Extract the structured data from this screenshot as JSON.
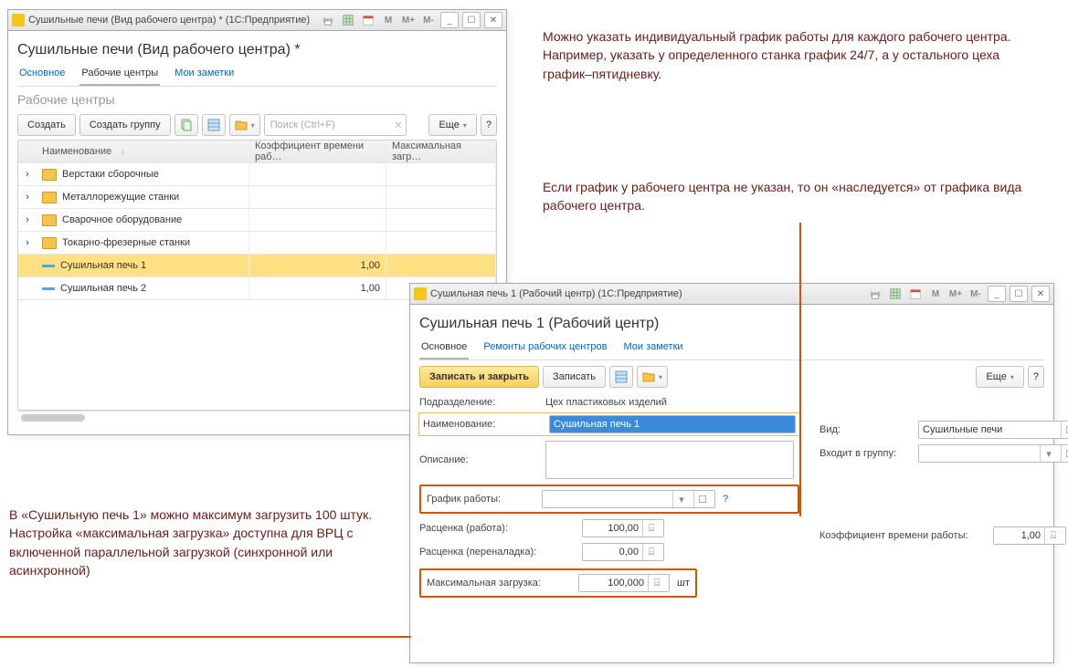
{
  "win1": {
    "titlebar": "Сушильные печи (Вид рабочего центра) * (1С:Предприятие)",
    "heading": "Сушильные печи (Вид рабочего центра) *",
    "tabs": {
      "main": "Основное",
      "centers": "Рабочие центры",
      "notes": "Мои заметки"
    },
    "subhead": "Рабочие центры",
    "toolbar": {
      "create": "Создать",
      "create_group": "Создать группу",
      "more": "Еще",
      "search_ph": "Поиск (Ctrl+F)"
    },
    "columns": {
      "name": "Наименование",
      "coef": "Коэффициент времени раб…",
      "load": "Максимальная загр…"
    },
    "rows": [
      {
        "type": "folder",
        "name": "Верстаки сборочные"
      },
      {
        "type": "folder",
        "name": "Металлорежущие станки"
      },
      {
        "type": "folder",
        "name": "Сварочное оборудование"
      },
      {
        "type": "folder",
        "name": "Токарно-фрезерные станки"
      },
      {
        "type": "leaf",
        "name": "Сушильная печь 1",
        "coef": "1,00",
        "selected": true
      },
      {
        "type": "leaf",
        "name": "Сушильная печь 2",
        "coef": "1,00"
      }
    ]
  },
  "win2": {
    "titlebar": "Сушильная печь 1 (Рабочий центр) (1С:Предприятие)",
    "heading": "Сушильная печь 1 (Рабочий центр)",
    "tabs": {
      "main": "Основное",
      "repairs": "Ремонты рабочих центров",
      "notes": "Мои заметки"
    },
    "toolbar": {
      "save_close": "Записать и закрыть",
      "save": "Записать",
      "more": "Еще"
    },
    "labels": {
      "unit": "Подразделение:",
      "name": "Наименование:",
      "desc": "Описание:",
      "schedule": "График работы:",
      "rate_work": "Расценка (работа):",
      "rate_setup": "Расценка (переналадка):",
      "max_load": "Максимальная загрузка:",
      "max_load_unit": "шт",
      "kind": "Вид:",
      "group": "Входит в группу:",
      "coef": "Коэффициент времени работы:"
    },
    "values": {
      "unit": "Цех пластиковых изделий",
      "name": "Сушильная печь 1",
      "rate_work": "100,00",
      "rate_setup": "0,00",
      "max_load": "100,000",
      "kind": "Сушильные печи",
      "coef": "1,00"
    }
  },
  "notes": {
    "top": "Можно указать индивидуальный  график работы для каждого рабочего центра. Например,  указать у определенного станка график 24/7, а у остального цеха график–пятидневку.",
    "mid": "Если график у рабочего центра не указан, то он «наследуется» от графика вида рабочего центра.",
    "left": "В «Сушильную печь 1» можно максимум загрузить 100 штук. Настройка «максимальная загрузка» доступна для ВРЦ с включенной параллельной загрузкой (синхронной или асинхронной)"
  },
  "glyphs": {
    "help": "?",
    "close": "✕",
    "min": "_",
    "max": "☐",
    "m": "M",
    "mplus": "M+",
    "mminus": "M-",
    "down": "▾",
    "expand": "›",
    "calc": "⌸",
    "open": "☐",
    "caretdown": "▾"
  }
}
